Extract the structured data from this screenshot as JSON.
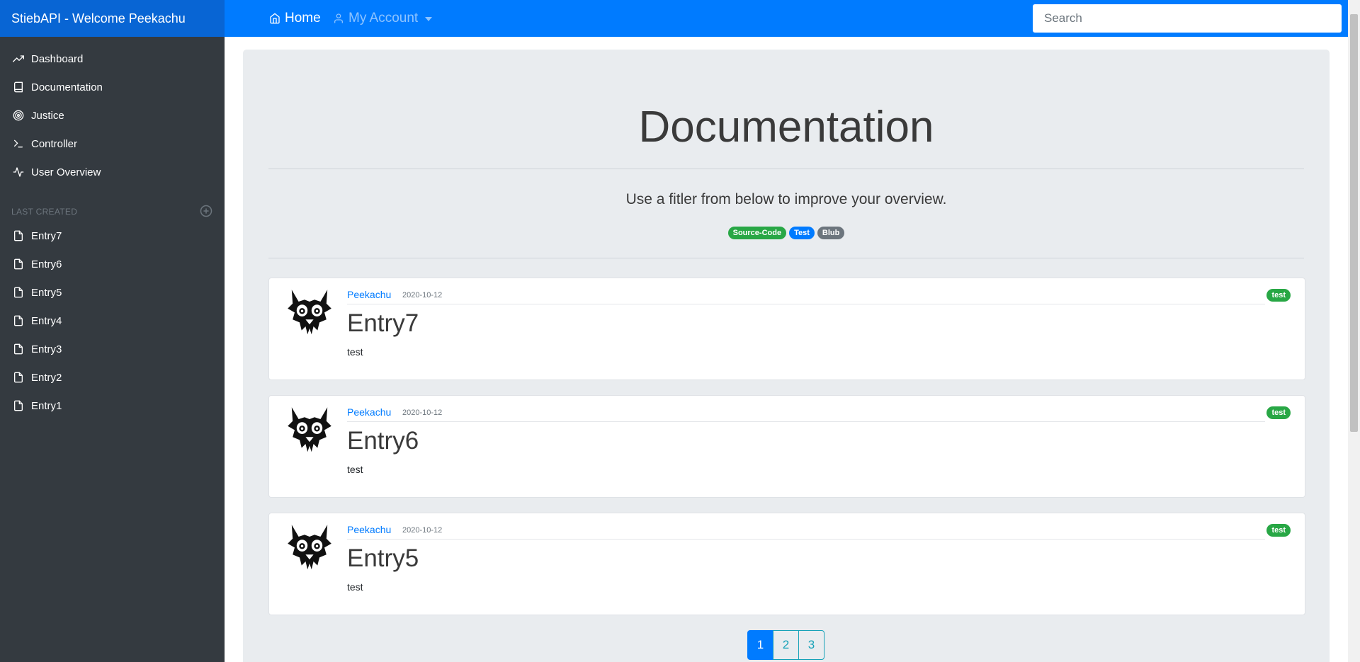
{
  "header": {
    "brand": "StiebAPI - Welcome Peekachu",
    "nav": {
      "home": "Home",
      "account": "My Account"
    },
    "search_placeholder": "Search"
  },
  "sidebar": {
    "items": [
      {
        "label": "Dashboard",
        "icon": "trending-up-icon"
      },
      {
        "label": "Documentation",
        "icon": "book-icon"
      },
      {
        "label": "Justice",
        "icon": "target-icon"
      },
      {
        "label": "Controller",
        "icon": "terminal-icon"
      },
      {
        "label": "User Overview",
        "icon": "activity-icon"
      }
    ],
    "section_heading": "LAST CREATED",
    "entries": [
      "Entry7",
      "Entry6",
      "Entry5",
      "Entry4",
      "Entry3",
      "Entry2",
      "Entry1"
    ]
  },
  "main": {
    "title": "Documentation",
    "lead": "Use a fitler from below to improve your overview.",
    "filters": [
      {
        "label": "Source-Code",
        "color": "#28a745"
      },
      {
        "label": "Test",
        "color": "#007bff"
      },
      {
        "label": "Blub",
        "color": "#6c757d"
      }
    ],
    "posts": [
      {
        "author": "Peekachu",
        "date": "2020-10-12",
        "title": "Entry7",
        "text": "test",
        "tag": "test"
      },
      {
        "author": "Peekachu",
        "date": "2020-10-12",
        "title": "Entry6",
        "text": "test",
        "tag": "test"
      },
      {
        "author": "Peekachu",
        "date": "2020-10-12",
        "title": "Entry5",
        "text": "test",
        "tag": "test"
      }
    ],
    "pagination": {
      "pages": [
        "1",
        "2",
        "3"
      ],
      "active": "1"
    }
  },
  "colors": {
    "primary": "#007bff",
    "sidebar_bg": "#343a40",
    "brand_bg": "#0865d4",
    "success": "#28a745",
    "info": "#17a2b8"
  }
}
